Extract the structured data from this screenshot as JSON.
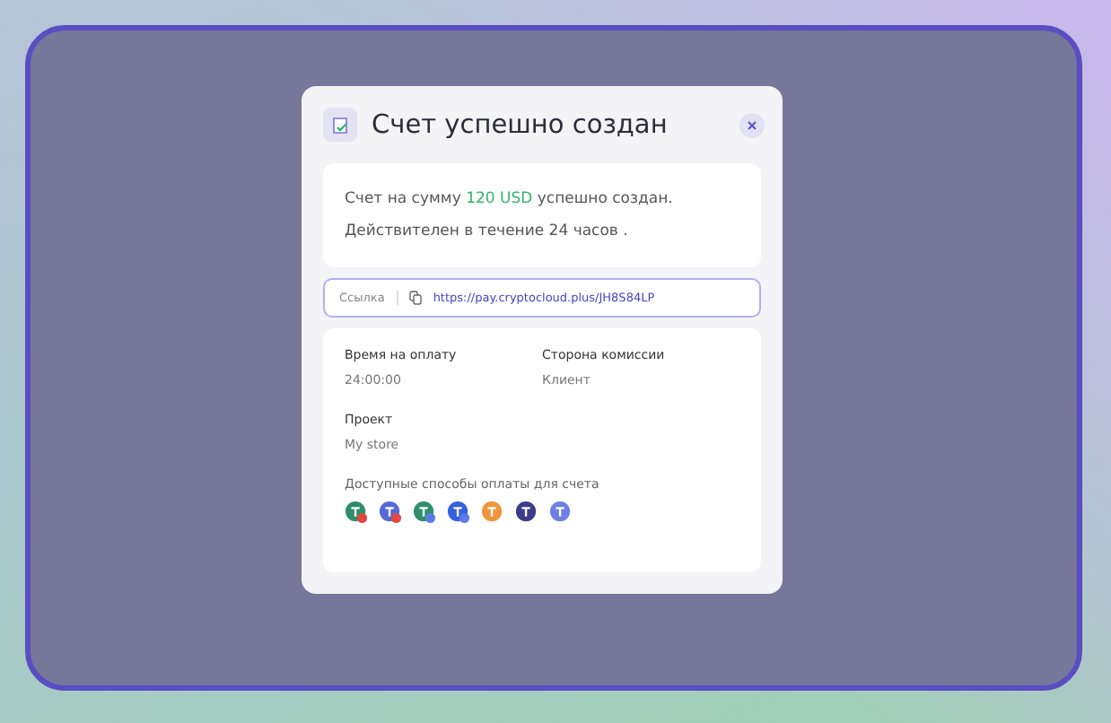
{
  "modal": {
    "title": "Счет успешно создан",
    "message": {
      "before": "Счет на сумму ",
      "amount": "120 USD",
      "after": " успешно создан.",
      "validity": "Действителен в течение 24 часов ."
    },
    "link": {
      "label": "Ссылка",
      "url": "https://pay.cryptocloud.plus/JH8S84LP"
    },
    "details": [
      {
        "label": "Время на оплату",
        "value": "24:00:00"
      },
      {
        "label": "Сторона комиссии",
        "value": "Клиент"
      },
      {
        "label": "Проект",
        "value": "My store"
      }
    ],
    "methods_label": "Доступные способы оплаты для счета",
    "methods": [
      {
        "color": "#2f8f6c",
        "kind": "tron"
      },
      {
        "color": "#5468d8",
        "kind": "tron"
      },
      {
        "color": "#2f8f6c",
        "kind": "eth"
      },
      {
        "color": "#3560e0",
        "kind": "eth"
      },
      {
        "color": "#f0953a",
        "kind": "coin"
      },
      {
        "color": "#3b3d8a",
        "kind": "coin"
      },
      {
        "color": "#6f7fe6",
        "kind": "coin"
      }
    ]
  }
}
